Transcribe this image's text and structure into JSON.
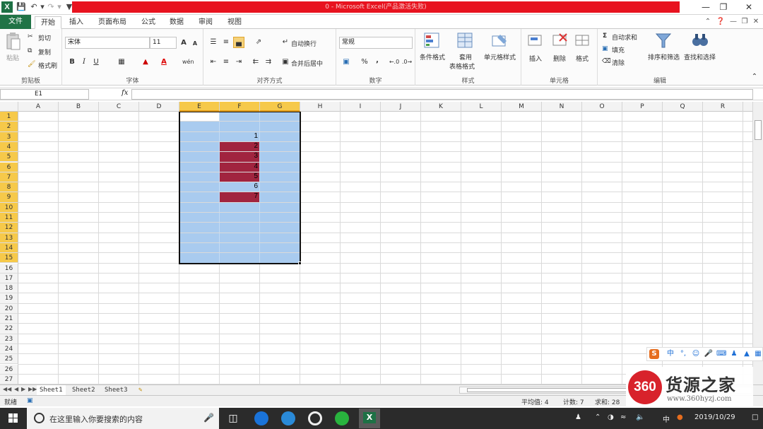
{
  "window": {
    "title": "0 - Microsoft Excel(产品激活失败)",
    "logo": "X",
    "colors": {
      "title_bar": "#e8131f",
      "file_tab": "#207346",
      "selection": "#a9cbef",
      "fill_red": "#a1243f",
      "header_highlight": "#f6c94a"
    }
  },
  "tabs": {
    "file": "文件",
    "home": "开始",
    "insert": "插入",
    "page_layout": "页面布局",
    "formulas": "公式",
    "data": "数据",
    "review": "审阅",
    "view": "视图"
  },
  "ribbon": {
    "clipboard": {
      "paste": "粘贴",
      "cut": "剪切",
      "copy": "复制",
      "format_painter": "格式刷",
      "label": "剪贴板"
    },
    "font": {
      "name": "宋体",
      "size": "11",
      "bold": "B",
      "italic": "I",
      "underline": "U",
      "label": "字体",
      "grow": "A",
      "shrink": "A",
      "color_a": "A",
      "phonetic": "wén"
    },
    "alignment": {
      "wrap": "自动换行",
      "merge": "合并后居中",
      "label": "对齐方式"
    },
    "number": {
      "format": "常规",
      "percent": "%",
      "comma": ",",
      "label": "数字"
    },
    "styles": {
      "conditional": "条件格式",
      "table_line1": "套用",
      "table_line2": "表格格式",
      "cell_styles": "单元格样式",
      "label": "样式"
    },
    "cells": {
      "insert": "插入",
      "delete": "删除",
      "format": "格式",
      "label": "单元格"
    },
    "editing": {
      "autosum": "自动求和",
      "fill": "填充",
      "clear": "清除",
      "sort": "排序和筛选",
      "find": "查找和选择",
      "label": "编辑"
    }
  },
  "formula_bar": {
    "name_box": "E1",
    "fx": "fx",
    "value": ""
  },
  "columns": [
    "A",
    "B",
    "C",
    "D",
    "E",
    "F",
    "G",
    "H",
    "I",
    "J",
    "K",
    "L",
    "M",
    "N",
    "O",
    "P",
    "Q",
    "R"
  ],
  "selected_columns": [
    "E",
    "F",
    "G"
  ],
  "rows": [
    "1",
    "2",
    "3",
    "4",
    "5",
    "6",
    "7",
    "8",
    "9",
    "10",
    "11",
    "12",
    "13",
    "14",
    "15",
    "16",
    "17",
    "18",
    "19",
    "20",
    "21",
    "22",
    "23",
    "24",
    "25",
    "26",
    "27"
  ],
  "selected_rows": [
    "1",
    "2",
    "3",
    "4",
    "5",
    "6",
    "7",
    "8",
    "9",
    "10",
    "11",
    "12",
    "13",
    "14",
    "15"
  ],
  "cells": [
    {
      "ref": "F3",
      "row": 3,
      "value": "1",
      "fill": "none"
    },
    {
      "ref": "F4",
      "row": 4,
      "value": "2",
      "fill": "red"
    },
    {
      "ref": "F5",
      "row": 5,
      "value": "3",
      "fill": "red"
    },
    {
      "ref": "F6",
      "row": 6,
      "value": "4",
      "fill": "red"
    },
    {
      "ref": "F7",
      "row": 7,
      "value": "5",
      "fill": "red"
    },
    {
      "ref": "F8",
      "row": 8,
      "value": "6",
      "fill": "none"
    },
    {
      "ref": "F9",
      "row": 9,
      "value": "7",
      "fill": "red"
    }
  ],
  "sheets": [
    "Sheet1",
    "Sheet2",
    "Sheet3"
  ],
  "status": {
    "ready": "就绪",
    "average": "平均值: 4",
    "count": "计数: 7",
    "sum": "求和: 28"
  },
  "ime": {
    "sogou": "S",
    "mode": "中",
    "punct": "°,"
  },
  "watermark": {
    "badge": "360",
    "title": "货源之家",
    "url": "www.360hyzj.com"
  },
  "taskbar": {
    "search_placeholder": "在这里输入你要搜索的内容",
    "ime": "中",
    "date": "2019/10/29"
  }
}
